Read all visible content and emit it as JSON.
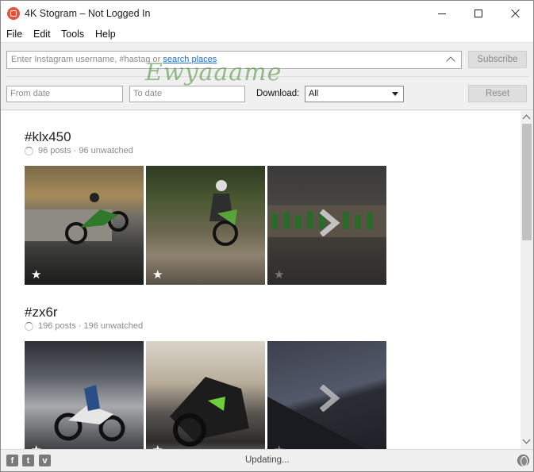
{
  "window": {
    "title": "4K Stogram – Not Logged In"
  },
  "menu": [
    "File",
    "Edit",
    "Tools",
    "Help"
  ],
  "toolbar": {
    "search_placeholder": "Enter Instagram username, #hastag or ",
    "search_link": "search places",
    "subscribe_label": "Subscribe",
    "from_date_placeholder": "From date",
    "to_date_placeholder": "To date",
    "download_label": "Download:",
    "download_value": "All",
    "reset_label": "Reset"
  },
  "watermark": "Ewyaaame",
  "feeds": [
    {
      "title": "#klx450",
      "posts": "96 posts",
      "unwatched": "96 unwatched"
    },
    {
      "title": "#zx6r",
      "posts": "196 posts",
      "unwatched": "196 unwatched"
    }
  ],
  "status": {
    "text": "Updating..."
  },
  "icons": {
    "social": [
      "facebook-icon",
      "twitter-icon",
      "vimeo-icon"
    ],
    "globe": "globe-icon"
  }
}
